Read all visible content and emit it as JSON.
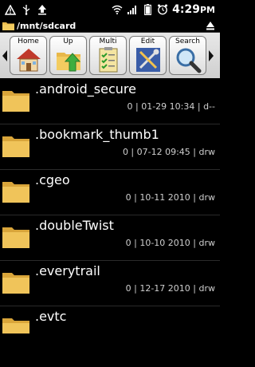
{
  "status": {
    "time": "4:29",
    "ampm": "PM"
  },
  "path": "/mnt/sdcard",
  "toolbar": [
    {
      "label": "Home"
    },
    {
      "label": "Up"
    },
    {
      "label": "Multi"
    },
    {
      "label": "Edit"
    },
    {
      "label": "Search"
    }
  ],
  "files": [
    {
      "name": ".android_secure",
      "meta": "0 | 01-29 10:34 | d--"
    },
    {
      "name": ".bookmark_thumb1",
      "meta": "0 | 07-12 09:45 | drw"
    },
    {
      "name": ".cgeo",
      "meta": "0 | 10-11 2010 | drw"
    },
    {
      "name": ".doubleTwist",
      "meta": "0 | 10-10 2010 | drw"
    },
    {
      "name": ".everytrail",
      "meta": "0 | 12-17 2010 | drw"
    },
    {
      "name": ".evtc",
      "meta": ""
    }
  ],
  "colors": {
    "folder": "#e8b84a",
    "toolbar_bg": "#d9d9d9"
  }
}
